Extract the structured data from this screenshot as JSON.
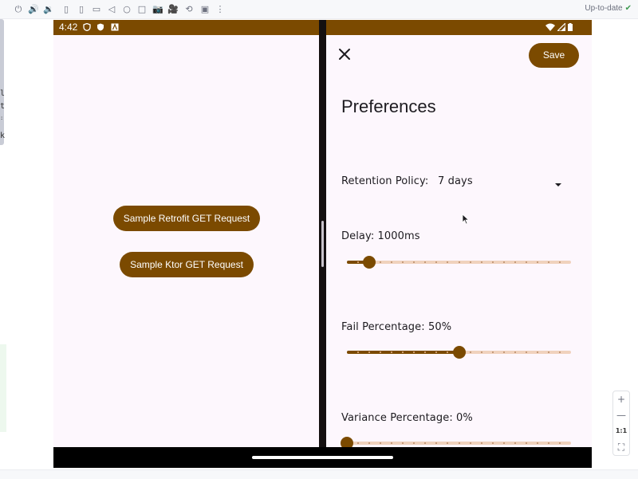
{
  "ide": {
    "status_text": "Up-to-date",
    "check_icon": "check-icon",
    "code_fragments": [
      "l",
      "t",
      ":",
      "k"
    ],
    "zoom": {
      "plus": "+",
      "minus": "—",
      "one_to_one": "1:1"
    }
  },
  "device": {
    "status_time": "4:42",
    "left_pane": {
      "retrofit_button": "Sample Retrofit GET Request",
      "ktor_button": "Sample Ktor GET Request"
    },
    "right_pane": {
      "save_label": "Save",
      "title": "Preferences",
      "retention_label": "Retention Policy:",
      "retention_value": "7 days",
      "delay_label": "Delay: 1000ms",
      "delay_fraction": 0.1,
      "fail_label": "Fail Percentage: 50%",
      "fail_fraction": 0.5,
      "variance_label": "Variance Percentage: 0%",
      "variance_fraction": 0.0
    }
  },
  "colors": {
    "brand": "#7b4a00",
    "track_inactive": "#f0d2bd",
    "surface": "#fdf7fd"
  }
}
